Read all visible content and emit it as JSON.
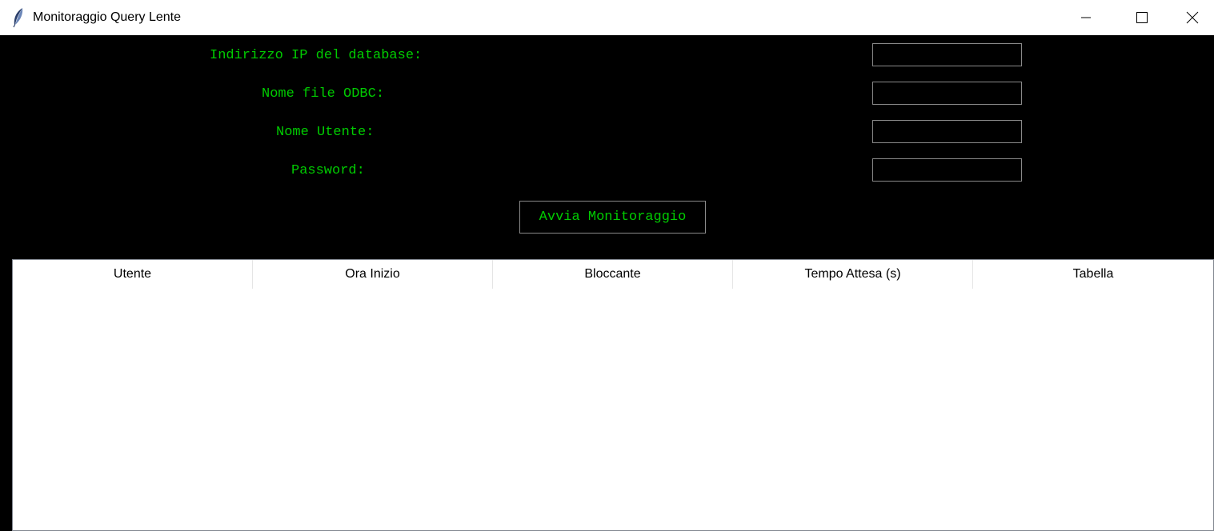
{
  "window": {
    "title": "Monitoraggio Query Lente",
    "icon": "feather-icon"
  },
  "form": {
    "fields": [
      {
        "label": "Indirizzo IP del database:",
        "value": ""
      },
      {
        "label": "Nome file ODBC:",
        "value": ""
      },
      {
        "label": "Nome Utente:",
        "value": ""
      },
      {
        "label": "Password:",
        "value": ""
      }
    ],
    "start_button": "Avvia Monitoraggio"
  },
  "table": {
    "columns": [
      "Utente",
      "Ora Inizio",
      "Bloccante",
      "Tempo Attesa (s)",
      "Tabella"
    ],
    "rows": []
  },
  "colors": {
    "background": "#000000",
    "text_accent": "#00cc00",
    "border": "#8a8a8a"
  }
}
